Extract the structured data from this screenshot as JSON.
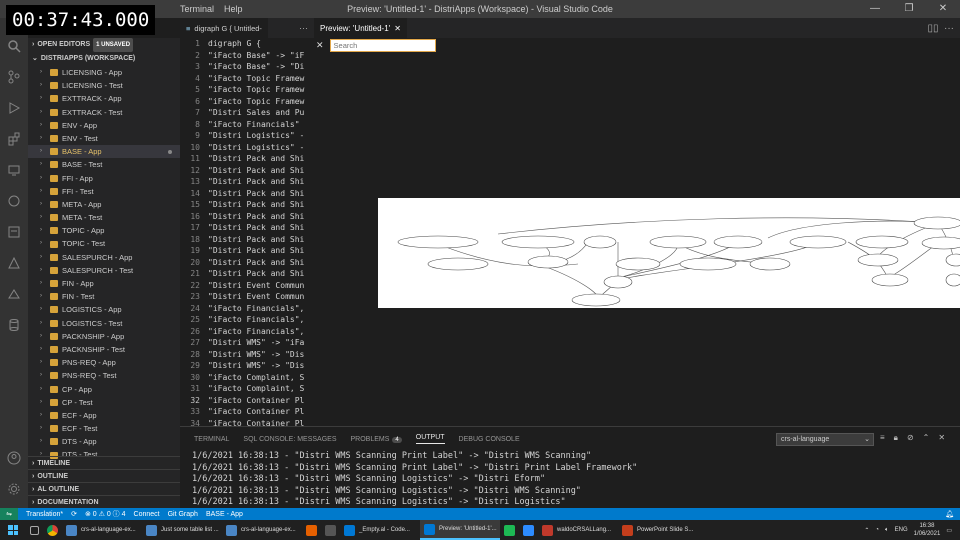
{
  "overlay": {
    "timestamp": "00:37:43.000"
  },
  "window": {
    "title": "Preview: 'Untitled-1' - DistriApps (Workspace) - Visual Studio Code",
    "menu": [
      "Terminal",
      "Help"
    ],
    "controls": [
      "—",
      "❐",
      "✕"
    ]
  },
  "sidebar": {
    "open_editors": "OPEN EDITORS",
    "unsaved_badge": "1 UNSAVED",
    "workspace": "DISTRIAPPS (WORKSPACE)",
    "items": [
      "LICENSING - App",
      "LICENSING - Test",
      "EXTTRACK - App",
      "EXTTRACK - Test",
      "ENV - App",
      "ENV - Test",
      "BASE - App",
      "BASE - Test",
      "FFI - App",
      "FFI - Test",
      "META - App",
      "META - Test",
      "TOPIC - App",
      "TOPIC - Test",
      "SALESPURCH - App",
      "SALESPURCH - Test",
      "FIN - App",
      "FIN - Test",
      "LOGISTICS - App",
      "LOGISTICS - Test",
      "PACKNSHIP - App",
      "PACKNSHIP - Test",
      "PNS-REQ - App",
      "PNS-REQ - Test",
      "CP - App",
      "CP - Test",
      "ECF - App",
      "ECF - Test",
      "DTS - App",
      "DTS - Test"
    ],
    "active_index": 6,
    "footer": [
      "TIMELINE",
      "OUTLINE",
      "AL OUTLINE",
      "DOCUMENTATION"
    ]
  },
  "editor": {
    "tab_label": "digraph G { Untitled-",
    "lines": [
      {
        "n": "1",
        "t": "digraph G {"
      },
      {
        "n": "2",
        "t": "\"iFacto Base\" -> \"iF"
      },
      {
        "n": "3",
        "t": "\"iFacto Base\" -> \"Di"
      },
      {
        "n": "4",
        "t": "\"iFacto Topic Framew"
      },
      {
        "n": "5",
        "t": "\"iFacto Topic Framew"
      },
      {
        "n": "6",
        "t": "\"iFacto Topic Framew"
      },
      {
        "n": "7",
        "t": "\"Distri Sales and Pu"
      },
      {
        "n": "8",
        "t": "\"iFacto Financials\""
      },
      {
        "n": "9",
        "t": "\"Distri Logistics\" -"
      },
      {
        "n": "10",
        "t": "\"Distri Logistics\" -"
      },
      {
        "n": "11",
        "t": "\"Distri Pack and Shi"
      },
      {
        "n": "12",
        "t": "\"Distri Pack and Shi"
      },
      {
        "n": "13",
        "t": "\"Distri Pack and Shi"
      },
      {
        "n": "14",
        "t": "\"Distri Pack and Shi"
      },
      {
        "n": "15",
        "t": "\"Distri Pack and Shi"
      },
      {
        "n": "16",
        "t": "\"Distri Pack and Shi"
      },
      {
        "n": "17",
        "t": "\"Distri Pack and Shi"
      },
      {
        "n": "18",
        "t": "\"Distri Pack and Shi"
      },
      {
        "n": "19",
        "t": "\"Distri Pack and Shi"
      },
      {
        "n": "20",
        "t": "\"Distri Pack and Shi"
      },
      {
        "n": "21",
        "t": "\"Distri Pack and Shi"
      },
      {
        "n": "22",
        "t": "\"Distri Event Commun"
      },
      {
        "n": "23",
        "t": "\"Distri Event Commun"
      },
      {
        "n": "24",
        "t": "\"iFacto Financials\","
      },
      {
        "n": "25",
        "t": "\"iFacto Financials\","
      },
      {
        "n": "26",
        "t": "\"iFacto Financials\","
      },
      {
        "n": "27",
        "t": "\"Distri WMS\" -> \"iFa"
      },
      {
        "n": "28",
        "t": "\"Distri WMS\" -> \"Dis"
      },
      {
        "n": "29",
        "t": "\"Distri WMS\" -> \"Dis"
      },
      {
        "n": "30",
        "t": "\"iFacto Complaint, S"
      },
      {
        "n": "31",
        "t": "\"iFacto Complaint, S"
      },
      {
        "n": "32",
        "t": "\"iFacto Container Pl"
      },
      {
        "n": "33",
        "t": "\"iFacto Container Pl"
      },
      {
        "n": "34",
        "t": "\"iFacto Container Pl"
      }
    ],
    "active_line": 32
  },
  "preview": {
    "tab_label": "Preview: 'Untitled-1'",
    "search_placeholder": "Search"
  },
  "panel": {
    "tabs": [
      "TERMINAL",
      "SQL CONSOLE: MESSAGES",
      "PROBLEMS",
      "OUTPUT",
      "DEBUG CONSOLE"
    ],
    "problems_count": "4",
    "active_tab": "OUTPUT",
    "channel": "crs-al-language",
    "output_lines": [
      "1/6/2021 16:38:13 - \"Distri WMS Scanning Print Label\" -> \"Distri WMS Scanning\"",
      "1/6/2021 16:38:13 - \"Distri WMS Scanning Print Label\" -> \"Distri Print Label Framework\"",
      "1/6/2021 16:38:13 - \"Distri WMS Scanning Logistics\" -> \"Distri Eform\"",
      "1/6/2021 16:38:13 - \"Distri WMS Scanning Logistics\" -> \"Distri WMS Scanning\"",
      "1/6/2021 16:38:13 - \"Distri WMS Scanning Logistics\" -> \"Distri Logistics\""
    ]
  },
  "statusbar": {
    "branch": "Translation*",
    "sync": "⟳",
    "errors": "⊗ 0  ⚠ 0  ⓘ 4",
    "connect": "Connect",
    "git_graph": "Git Graph",
    "project": "BASE - App"
  },
  "taskbar": {
    "items": [
      {
        "label": "crs-al-language-ex...",
        "color": "#4a86c5"
      },
      {
        "label": "Just some table list ...",
        "color": "#4a86c5"
      },
      {
        "label": "crs-al-language-ex...",
        "color": "#4a86c5"
      },
      {
        "label": "",
        "color": "#e66000"
      },
      {
        "label": "",
        "color": "#555555"
      },
      {
        "label": "_Empty.al - Code...",
        "color": "#0078d4"
      },
      {
        "label": "Preview: 'Untitled-1'...",
        "color": "#0078d4"
      },
      {
        "label": "",
        "color": "#1db954"
      },
      {
        "label": "",
        "color": "#2d8cff"
      },
      {
        "label": "waldoCRSALLang...",
        "color": "#c0392b"
      },
      {
        "label": "PowerPoint Slide S...",
        "color": "#c43e1c"
      }
    ],
    "active_index": 6,
    "lang": "ENG",
    "time": "16:38",
    "date": "1/06/2021"
  }
}
